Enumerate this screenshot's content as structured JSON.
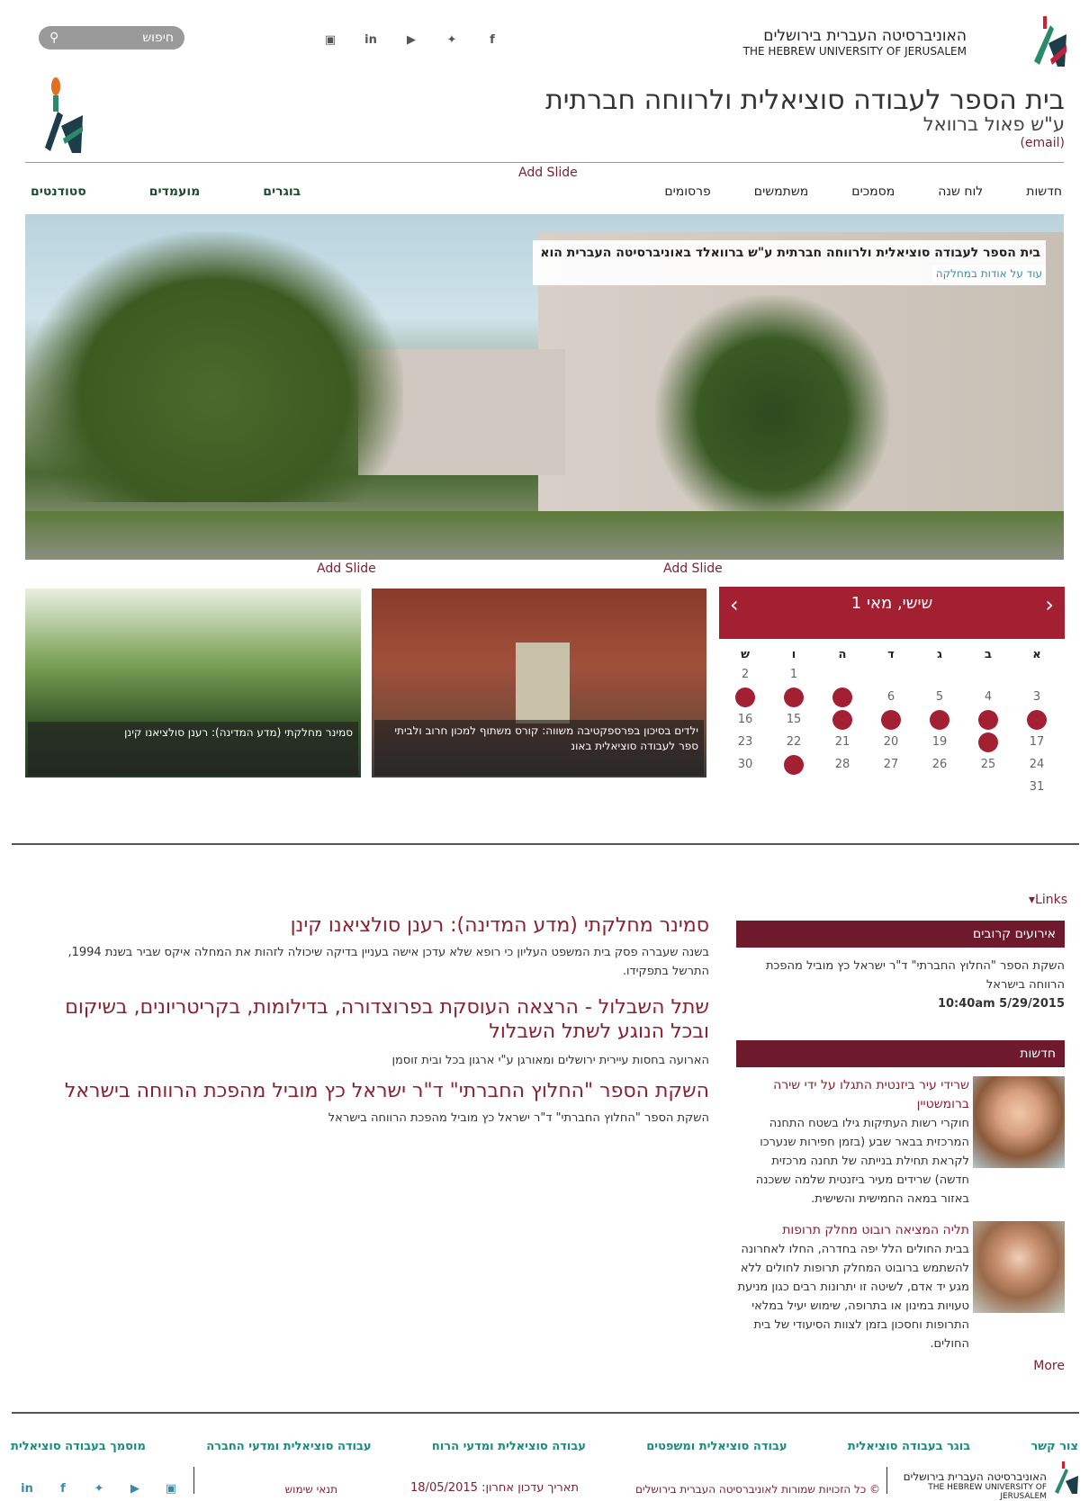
{
  "header": {
    "uni_he": "האוניברסיטה העברית בירושלים",
    "uni_en": "THE HEBREW UNIVERSITY OF JERUSALEM",
    "search_placeholder": "חיפוש",
    "school_title": "בית הספר לעבודה סוציאלית ולרווחה חברתית",
    "school_sub": "ע\"ש פאול ברוואל",
    "email": "(email)"
  },
  "social": [
    "f",
    "twitter",
    "youtube",
    "in",
    "instagram"
  ],
  "nav": {
    "add_slide": "Add Slide",
    "right": [
      "חדשות",
      "לוח שנה",
      "מסמכים",
      "משתמשים",
      "פרסומים"
    ],
    "left": [
      "בוגרים",
      "מועמדים",
      "סטודנטים"
    ]
  },
  "hero": {
    "title": "בית הספר לעבודה סוציאלית ולרווחה חברתית ע\"ש ברוואלד באוניברסיטה העברית הוא המוביל בהכשרה",
    "link": "עוד על אודות במחלקה"
  },
  "slides": {
    "add1": "Add Slide",
    "add2": "Add Slide",
    "cap1": "סמינר מחלקתי (מדע המדינה): רענן סולציאנו קינן",
    "cap2": "ילדים בסיכון בפרספקטיבה משווה: קורס משתוף למכון חרוב ולביתי ספר לעבודה סוציאלית באונ"
  },
  "calendar": {
    "title": "שישי, מאי 1",
    "prev": "‹",
    "next": "›",
    "weekdays": [
      "א",
      "ב",
      "ג",
      "ד",
      "ה",
      "ו",
      "ש"
    ],
    "rows": [
      [
        null,
        null,
        null,
        null,
        null,
        "1",
        "2"
      ],
      [
        "3",
        "4",
        "5",
        "6",
        "7",
        "8",
        "9"
      ],
      [
        "10",
        "11",
        "12",
        "13",
        "14",
        "15",
        "16"
      ],
      [
        "17",
        "18",
        "19",
        "20",
        "21",
        "22",
        "23"
      ],
      [
        "24",
        "25",
        "26",
        "27",
        "28",
        "29",
        "30"
      ],
      [
        "31",
        null,
        null,
        null,
        null,
        null,
        null
      ]
    ],
    "events": [
      "7",
      "8",
      "9",
      "10",
      "11",
      "12",
      "13",
      "14",
      "18",
      "29"
    ]
  },
  "links_label": "Links",
  "articles": [
    {
      "title": "סמינר מחלקתי (מדע המדינה): רענן סולציאנו קינן",
      "body": "בשנה שעברה פסק בית המשפט העליון כי רופא שלא עדכן אישה בעניין בדיקה שיכולה לזהות את המחלה איקס שביר בשנת 1994, התרשל בתפקידו."
    },
    {
      "title": "שתל השבלול - הרצאה העוסקת בפרוצדורה, בדילומות, בקריטריונים, בשיקום ובכל הנוגע לשתל השבלול",
      "body": "הארועה בחסות עיירית ירושלים ומאורגן ע\"י ארגון בכל ובית זוסמן"
    },
    {
      "title": "השקת הספר \"החלוץ החברתי\" ד\"ר ישראל כץ מוביל מהפכת הרווחה בישראל",
      "body": "השקת הספר \"החלוץ החברתי\" ד\"ר ישראל כץ מוביל מהפכת הרווחה בישראל"
    }
  ],
  "sidebar": {
    "events_title": "אירועים קרובים",
    "event_text": "השקת הספר \"החלוץ החברתי\" ד\"ר ישראל כץ מוביל מהפכת הרווחה בישראל",
    "event_time": "10:40am 5/29/2015",
    "news_title": "חדשות",
    "news": [
      {
        "title": "שרידי עיר ביזנטית התגלו על ידי שירה ברומשטיין",
        "body": "חוקרי רשות העתיקות גילו בשטח התחנה המרכזית בבאר שבע (בזמן חפירות שנערכו לקראת תחילת בנייתה של תחנה מרכזית חדשה) שרידים מעיר ביזנטית שלמה ששכנה באזור במאה החמישית והשישית."
      },
      {
        "title": "תליה המציאה רובוט מחלק תרופות",
        "body": "בבית החולים הלל יפה בחדרה, החלו לאחרונה להשתמש ברובוט המחלק תרופות לחולים ללא מגע יד אדם, לשיטה זו יתרונות רבים כגון מניעת טעויות במינון או בתרופה, שימוש יעיל במלאי התרופות וחסכון בזמן לצוות הסיעודי של בית החולים."
      }
    ],
    "more": "More"
  },
  "footer": {
    "links": [
      "צור קשר",
      "בוגר בעבודה סוציאלית",
      "עבודה סוציאלית ומשפטים",
      "עבודה סוציאלית ומדעי הרוח",
      "עבודה סוציאלית ומדעי החברה",
      "מוסמך בעבודה סוציאלית"
    ],
    "copyright": "© כל הזכויות שמורות לאוניברסיטה העברית בירושלים",
    "updated": "תאריך עדכון אחרון: 18/05/2015",
    "terms": "תנאי שימוש"
  },
  "colors": {
    "maroon": "#7b2230",
    "event": "#a32033",
    "teal": "#1d8a7a"
  }
}
